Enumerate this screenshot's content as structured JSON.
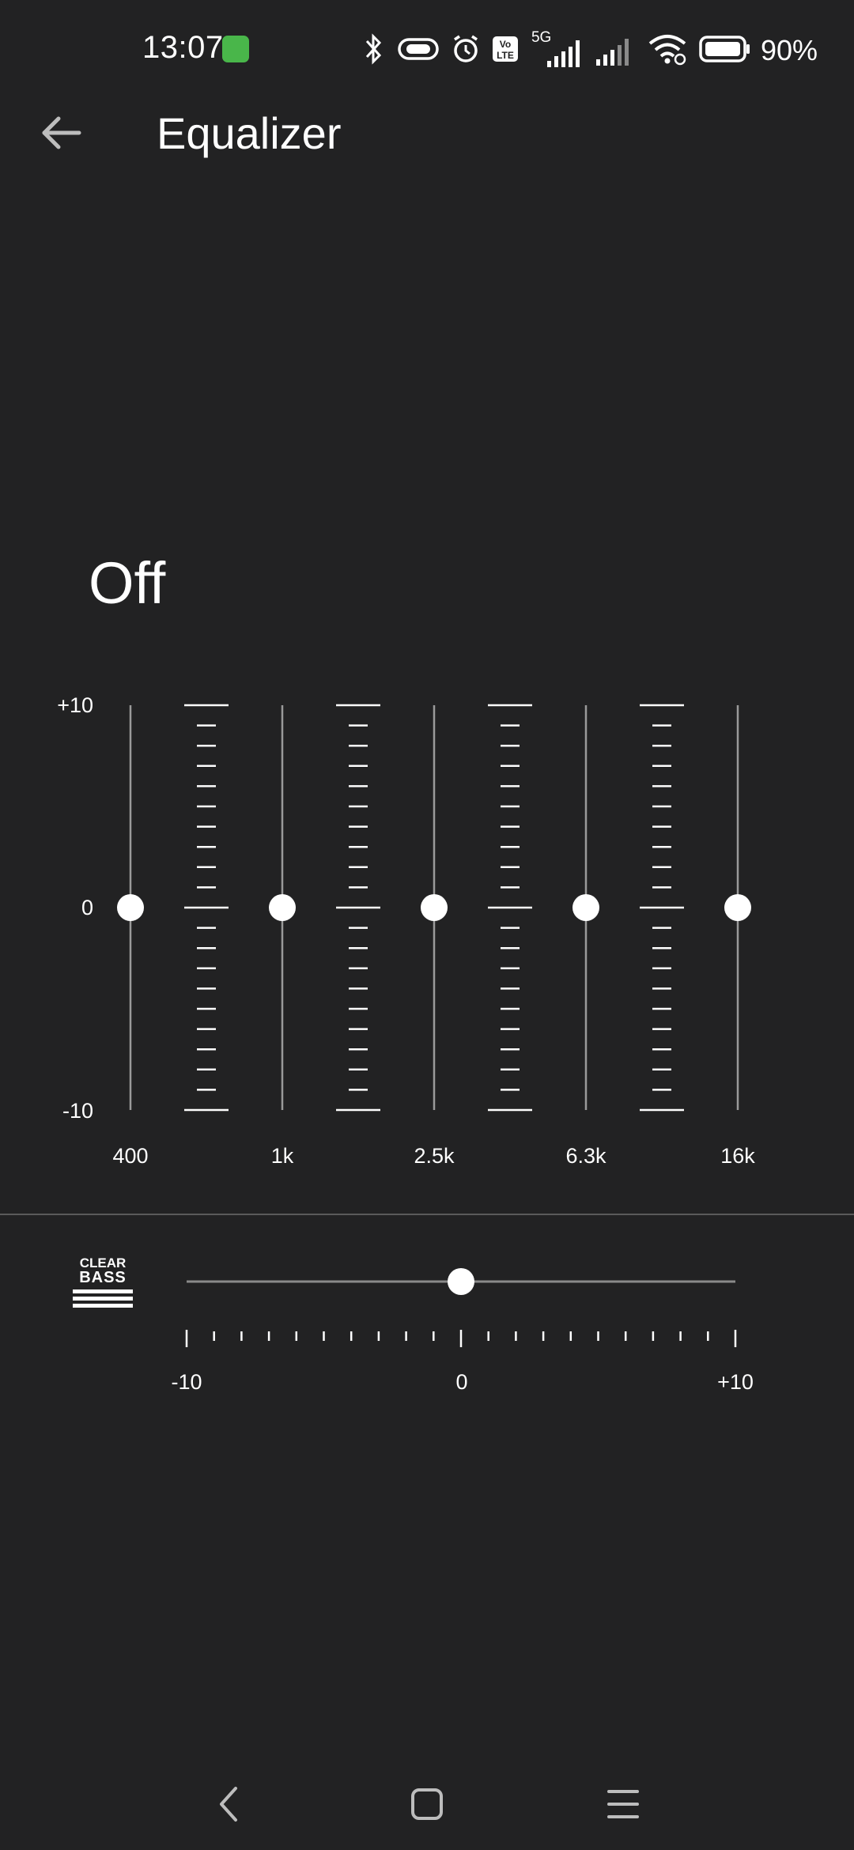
{
  "status_bar": {
    "time": "13:07",
    "network_type": "5G",
    "volte": "Vo\nLTE",
    "battery_percent": "90%",
    "icons": [
      "green-app-icon",
      "bluetooth-icon",
      "link-pill-icon",
      "alarm-icon",
      "volte-icon",
      "signal-5g-icon",
      "signal-icon",
      "wifi-icon",
      "battery-icon"
    ]
  },
  "header": {
    "title": "Equalizer",
    "back_icon": "arrow-left-icon"
  },
  "preset": {
    "label": "Off"
  },
  "equalizer": {
    "y_labels": {
      "top": "+10",
      "mid": "0",
      "bottom": "-10"
    },
    "bands": [
      {
        "label": "400",
        "value": 0
      },
      {
        "label": "1k",
        "value": 0
      },
      {
        "label": "2.5k",
        "value": 0
      },
      {
        "label": "6.3k",
        "value": 0
      },
      {
        "label": "16k",
        "value": 0
      }
    ],
    "range": [
      -10,
      10
    ]
  },
  "clear_bass": {
    "logo_line1": "CLEAR",
    "logo_line2": "BASS",
    "value": 0,
    "range": [
      -10,
      10
    ],
    "min_label": "-10",
    "mid_label": "0",
    "max_label": "+10"
  },
  "nav_bar": {
    "icons": [
      "back-chevron-icon",
      "home-square-icon",
      "menu-lines-icon"
    ]
  },
  "colors": {
    "background": "#222223",
    "foreground": "#ffffff",
    "track": "#9a9a9a",
    "divider": "#5a5a5a",
    "app_badge": "#49b64a"
  }
}
